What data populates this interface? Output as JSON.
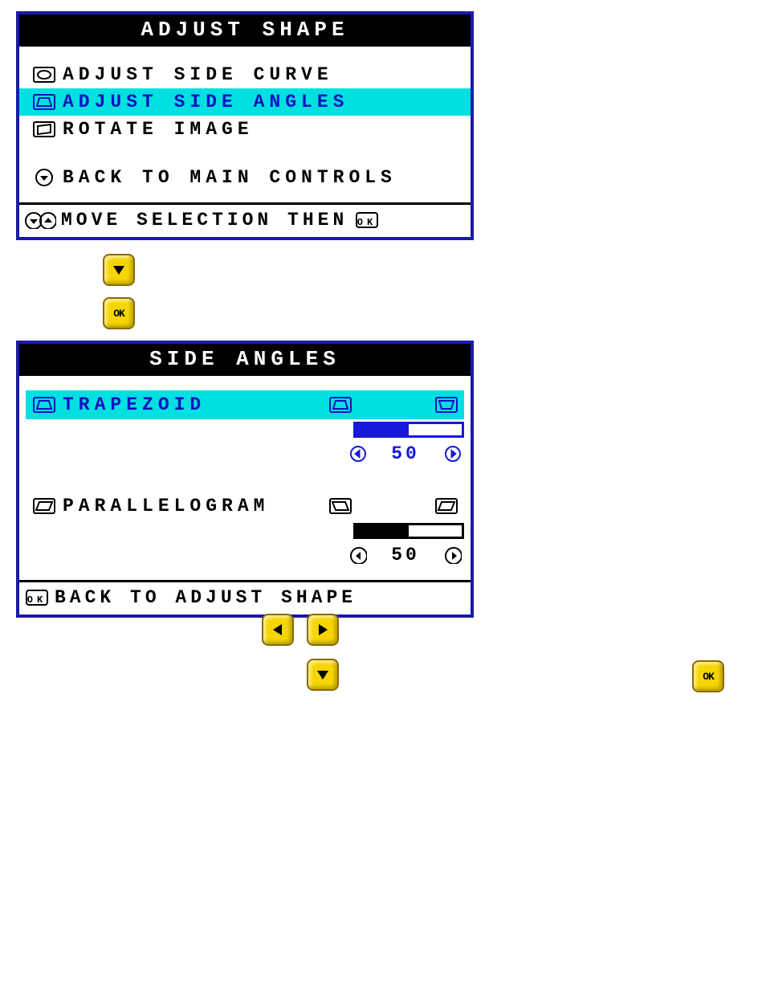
{
  "panel1": {
    "title": "ADJUST SHAPE",
    "items": [
      {
        "label": "ADJUST SIDE CURVE",
        "icon": "pincushion",
        "selected": false
      },
      {
        "label": "ADJUST SIDE ANGLES",
        "icon": "trapezoid-up",
        "selected": true
      },
      {
        "label": "ROTATE IMAGE",
        "icon": "rotate",
        "selected": false
      }
    ],
    "back": {
      "label": "BACK TO MAIN CONTROLS",
      "icon": "down-in-circle"
    },
    "footer": "MOVE SELECTION THEN"
  },
  "panel2": {
    "title": "SIDE ANGLES",
    "items": [
      {
        "name": "TRAPEZOID",
        "icon": "trapezoid-up",
        "dir_icon_a": "trap-up",
        "dir_icon_b": "trap-down",
        "value": "50",
        "selected": true
      },
      {
        "name": "PARALLELOGRAM",
        "icon": "parallelogram",
        "dir_icon_a": "para-left",
        "dir_icon_b": "para-right",
        "value": "50",
        "selected": false
      }
    ],
    "footer": "BACK TO ADJUST SHAPE"
  },
  "buttons": {
    "b1": "down",
    "b2": "ok",
    "b3": "left",
    "b4": "right",
    "b5": "down",
    "b6": "ok"
  }
}
